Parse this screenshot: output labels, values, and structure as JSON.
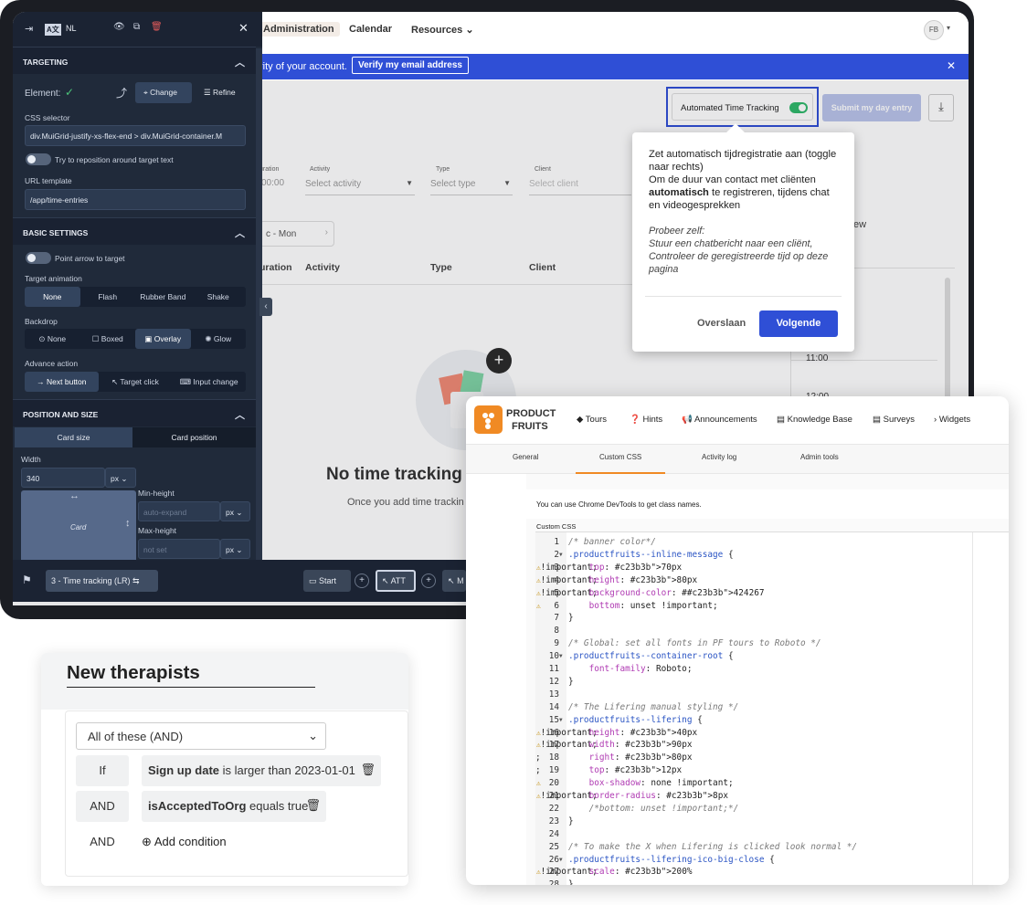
{
  "app": {
    "nav": [
      "Administration",
      "Calendar",
      "Resources"
    ],
    "avatar": "FB",
    "banner_text": "rity of your account.",
    "banner_button": "Verify my email address",
    "banner_close": "✕",
    "toggle_label": "Automated Time Tracking",
    "submit_label": "Submit my day entry",
    "filters": {
      "duration_label": "uration",
      "duration_value": "00:00",
      "activity_label": "Activity",
      "activity_placeholder": "Select activity",
      "type_label": "Type",
      "type_placeholder": "Select type",
      "client_label": "Client",
      "client_placeholder": "Select client"
    },
    "date_chip": "c - Mon",
    "view_label": "ew",
    "columns": [
      "uration",
      "Activity",
      "Type",
      "Client"
    ],
    "times": [
      "11:00",
      "12:00"
    ],
    "empty_title": "No time tracking",
    "empty_sub": "Once you add time trackin"
  },
  "panel": {
    "lang": "NL",
    "targeting_title": "TARGETING",
    "element_label": "Element:",
    "change_label": "Change",
    "refine_label": "Refine",
    "css_selector_label": "CSS selector",
    "css_selector_value": "div.MuiGrid-justify-xs-flex-end > div.MuiGrid-container.M",
    "reposition_label": "Try to reposition around target text",
    "url_template_label": "URL template",
    "url_template_value": "/app/time-entries",
    "basic_title": "BASIC SETTINGS",
    "point_arrow_label": "Point arrow to target",
    "animation_label": "Target animation",
    "animations": [
      "None",
      "Flash",
      "Rubber Band",
      "Shake"
    ],
    "backdrop_label": "Backdrop",
    "backdrops": [
      "None",
      "Boxed",
      "Overlay",
      "Glow"
    ],
    "advance_label": "Advance action",
    "advances": [
      "Next button",
      "Target click",
      "Input change"
    ],
    "position_title": "POSITION AND SIZE",
    "size_tabs": [
      "Card size",
      "Card position"
    ],
    "width_label": "Width",
    "width_value": "340",
    "unit": "px",
    "card_label": "Card",
    "min_height_label": "Min-height",
    "min_height_placeholder": "auto-expand",
    "max_height_label": "Max-height",
    "max_height_placeholder": "not set"
  },
  "bottombar": {
    "step": "3 - Time tracking (LR)",
    "chips": [
      "Start",
      "ATT",
      "M"
    ]
  },
  "tooltip": {
    "line1": "Zet automatisch tijdregistratie aan (toggle naar rechts)",
    "line2_pre": "Om de duur van contact met cliënten ",
    "line2_bold": "automatisch",
    "line2_post": " te registreren, tijdens chat en videogesprekken",
    "try_title": "Probeer zelf:",
    "try_1": "Stuur een chatbericht naar een cliënt,",
    "try_2": "Controleer de geregistreerde tijd op deze pagina",
    "skip": "Overslaan",
    "next": "Volgende"
  },
  "pf": {
    "brand_1": "PRODUCT",
    "brand_2": "FRUITS",
    "nav": [
      "Tours",
      "Hints",
      "Announcements",
      "Knowledge Base",
      "Surveys",
      "Widgets"
    ],
    "tabs": [
      "General",
      "Custom CSS",
      "Activity log",
      "Admin tools"
    ],
    "hint": "You can use Chrome DevTools to get class names.",
    "css_label": "Custom CSS",
    "code": [
      {
        "n": "1",
        "t": "/* banner color*/"
      },
      {
        "n": "2",
        "t": ".productfruits--inline-message {",
        "fold": true
      },
      {
        "n": "3",
        "t": "    top: 70px !important;",
        "warn": true
      },
      {
        "n": "4",
        "t": "    height: 80px !important;",
        "warn": true
      },
      {
        "n": "5",
        "t": "    background-color: #424267 !important;",
        "warn": true
      },
      {
        "n": "6",
        "t": "    bottom: unset !important;",
        "warn": true
      },
      {
        "n": "7",
        "t": "}"
      },
      {
        "n": "8",
        "t": ""
      },
      {
        "n": "9",
        "t": "/* Global: set all fonts in PF tours to Roboto */"
      },
      {
        "n": "10",
        "t": ".productfruits--container-root {",
        "fold": true
      },
      {
        "n": "11",
        "t": "    font-family: Roboto;"
      },
      {
        "n": "12",
        "t": "}"
      },
      {
        "n": "13",
        "t": ""
      },
      {
        "n": "14",
        "t": "/* The Lifering manual styling */"
      },
      {
        "n": "15",
        "t": ".productfruits--lifering {",
        "fold": true
      },
      {
        "n": "16",
        "t": "    height: 40px !important;",
        "warn": true
      },
      {
        "n": "17",
        "t": "    width: 90px !important;",
        "warn": true
      },
      {
        "n": "18",
        "t": "    right: 80px;"
      },
      {
        "n": "19",
        "t": "    top: 12px;"
      },
      {
        "n": "20",
        "t": "    box-shadow: none !important;",
        "warn": true
      },
      {
        "n": "21",
        "t": "    border-radius: 8px !important;",
        "warn": true
      },
      {
        "n": "22",
        "t": "    /*bottom: unset !important;*/"
      },
      {
        "n": "23",
        "t": "}"
      },
      {
        "n": "24",
        "t": ""
      },
      {
        "n": "25",
        "t": "/* To make the X when Lifering is clicked look normal */"
      },
      {
        "n": "26",
        "t": ".productfruits--lifering-ico-big-close {",
        "fold": true
      },
      {
        "n": "27",
        "t": "    scale: 200% !important;",
        "warn": true
      },
      {
        "n": "28",
        "t": "}"
      }
    ]
  },
  "therapists": {
    "title": "New therapists",
    "group_select": "All of these (AND)",
    "if_label": "If",
    "and_label": "AND",
    "cond1_bold": "Sign up date",
    "cond1_rest": " is larger than 2023-01-01",
    "cond2_bold": "isAcceptedToOrg",
    "cond2_rest": " equals true",
    "add_condition": "Add condition"
  },
  "colors": {
    "accent": "#2f4fd6",
    "panel": "#202a3a",
    "pf_orange": "#f08a24",
    "warn": "#c28a00"
  }
}
